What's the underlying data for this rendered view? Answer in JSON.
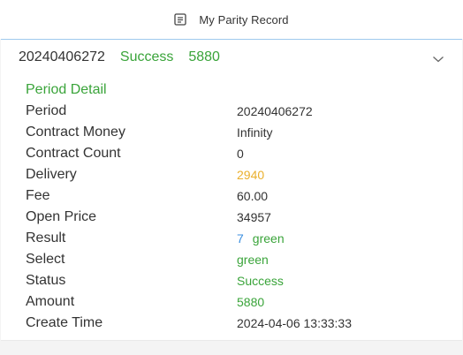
{
  "header": {
    "title": "My Parity Record",
    "icon": "record-icon"
  },
  "record": {
    "summary": {
      "period": "20240406272",
      "status": "Success",
      "amount": "5880"
    },
    "detail_title": "Period Detail",
    "labels": {
      "period": "Period",
      "contract_money": "Contract Money",
      "contract_count": "Contract Count",
      "delivery": "Delivery",
      "fee": "Fee",
      "open_price": "Open Price",
      "result": "Result",
      "select": "Select",
      "status": "Status",
      "amount": "Amount",
      "create_time": "Create Time"
    },
    "values": {
      "period": "20240406272",
      "contract_money": "Infinity",
      "contract_count": "0",
      "delivery": "2940",
      "fee": "60.00",
      "open_price": "34957",
      "result_number": "7",
      "result_color": "green",
      "select": "green",
      "status": "Success",
      "amount": "5880",
      "create_time": "2024-04-06 13:33:33"
    }
  },
  "colors": {
    "success_green": "#3aa43a",
    "delivery_orange": "#eab02e",
    "result_blue": "#3b8fe0",
    "accent_border": "#9fc9ee"
  }
}
